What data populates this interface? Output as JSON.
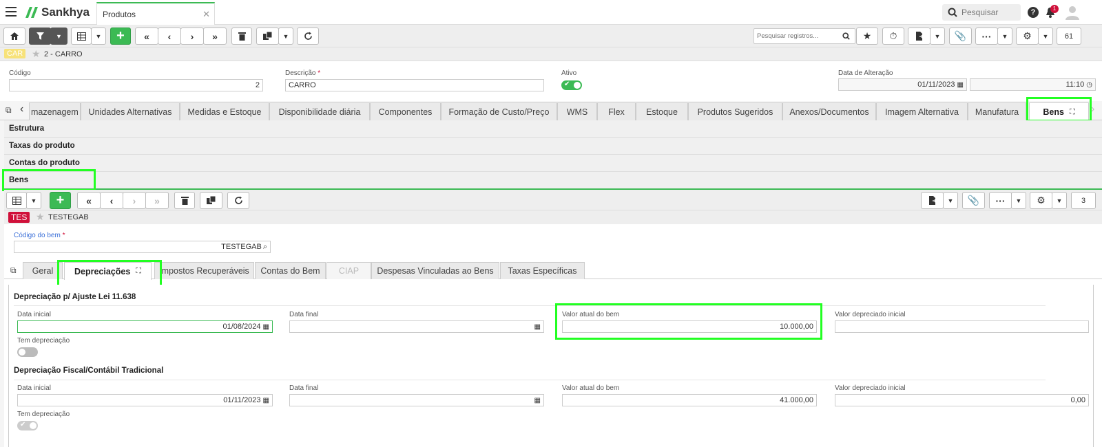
{
  "app": {
    "brand": "Sankhya",
    "tab_title": "Produtos",
    "search_placeholder": "Pesquisar",
    "notif_count": "1"
  },
  "toolbar": {
    "search_placeholder": "Pesquisar registros...",
    "record_count": "61"
  },
  "record": {
    "badge": "CAR",
    "title": "2 - CARRO"
  },
  "form": {
    "codigo_label": "Código",
    "codigo_value": "2",
    "descricao_label": "Descrição",
    "descricao_value": "CARRO",
    "ativo_label": "Ativo",
    "data_alt_label": "Data de Alteração",
    "data_alt_date": "01/11/2023",
    "data_alt_time": "11:10"
  },
  "tabs": [
    "mazenagem",
    "Unidades Alternativas",
    "Medidas e Estoque",
    "Disponibilidade diária",
    "Componentes",
    "Formação de Custo/Preço",
    "WMS",
    "Flex",
    "Estoque",
    "Produtos Sugeridos",
    "Anexos/Documentos",
    "Imagem Alternativa",
    "Manufatura",
    "Bens"
  ],
  "sections": [
    "Estrutura",
    "Taxas do produto",
    "Contas do produto",
    "Bens"
  ],
  "sub": {
    "record_count": "3",
    "badge": "TES",
    "title": "TESTEGAB",
    "codigo_bem_label": "Código do bem",
    "codigo_bem_value": "TESTEGAB",
    "tabs": [
      "Geral",
      "Depreciações",
      "Impostos Recuperáveis",
      "Contas do Bem",
      "CIAP",
      "Despesas Vinculadas ao Bens",
      "Taxas Específicas"
    ]
  },
  "dep1": {
    "title": "Depreciação p/ Ajuste Lei 11.638",
    "data_inicial_label": "Data inicial",
    "data_inicial": "01/08/2024",
    "data_final_label": "Data final",
    "data_final": "",
    "valor_atual_label": "Valor atual do bem",
    "valor_atual": "10.000,00",
    "valor_dep_label": "Valor depreciado inicial",
    "valor_dep": "",
    "tem_dep_label": "Tem depreciação"
  },
  "dep2": {
    "title": "Depreciação Fiscal/Contábil Tradicional",
    "data_inicial_label": "Data inicial",
    "data_inicial": "01/11/2023",
    "data_final_label": "Data final",
    "data_final": "",
    "valor_atual_label": "Valor atual do bem",
    "valor_atual": "41.000,00",
    "valor_dep_label": "Valor depreciado inicial",
    "valor_dep": "0,00",
    "tem_dep_label": "Tem depreciação"
  },
  "colors": {
    "accent_green": "#3cba54",
    "highlight": "#22ff22",
    "badge_red": "#d0103a",
    "badge_yellow": "#f7e27a"
  }
}
